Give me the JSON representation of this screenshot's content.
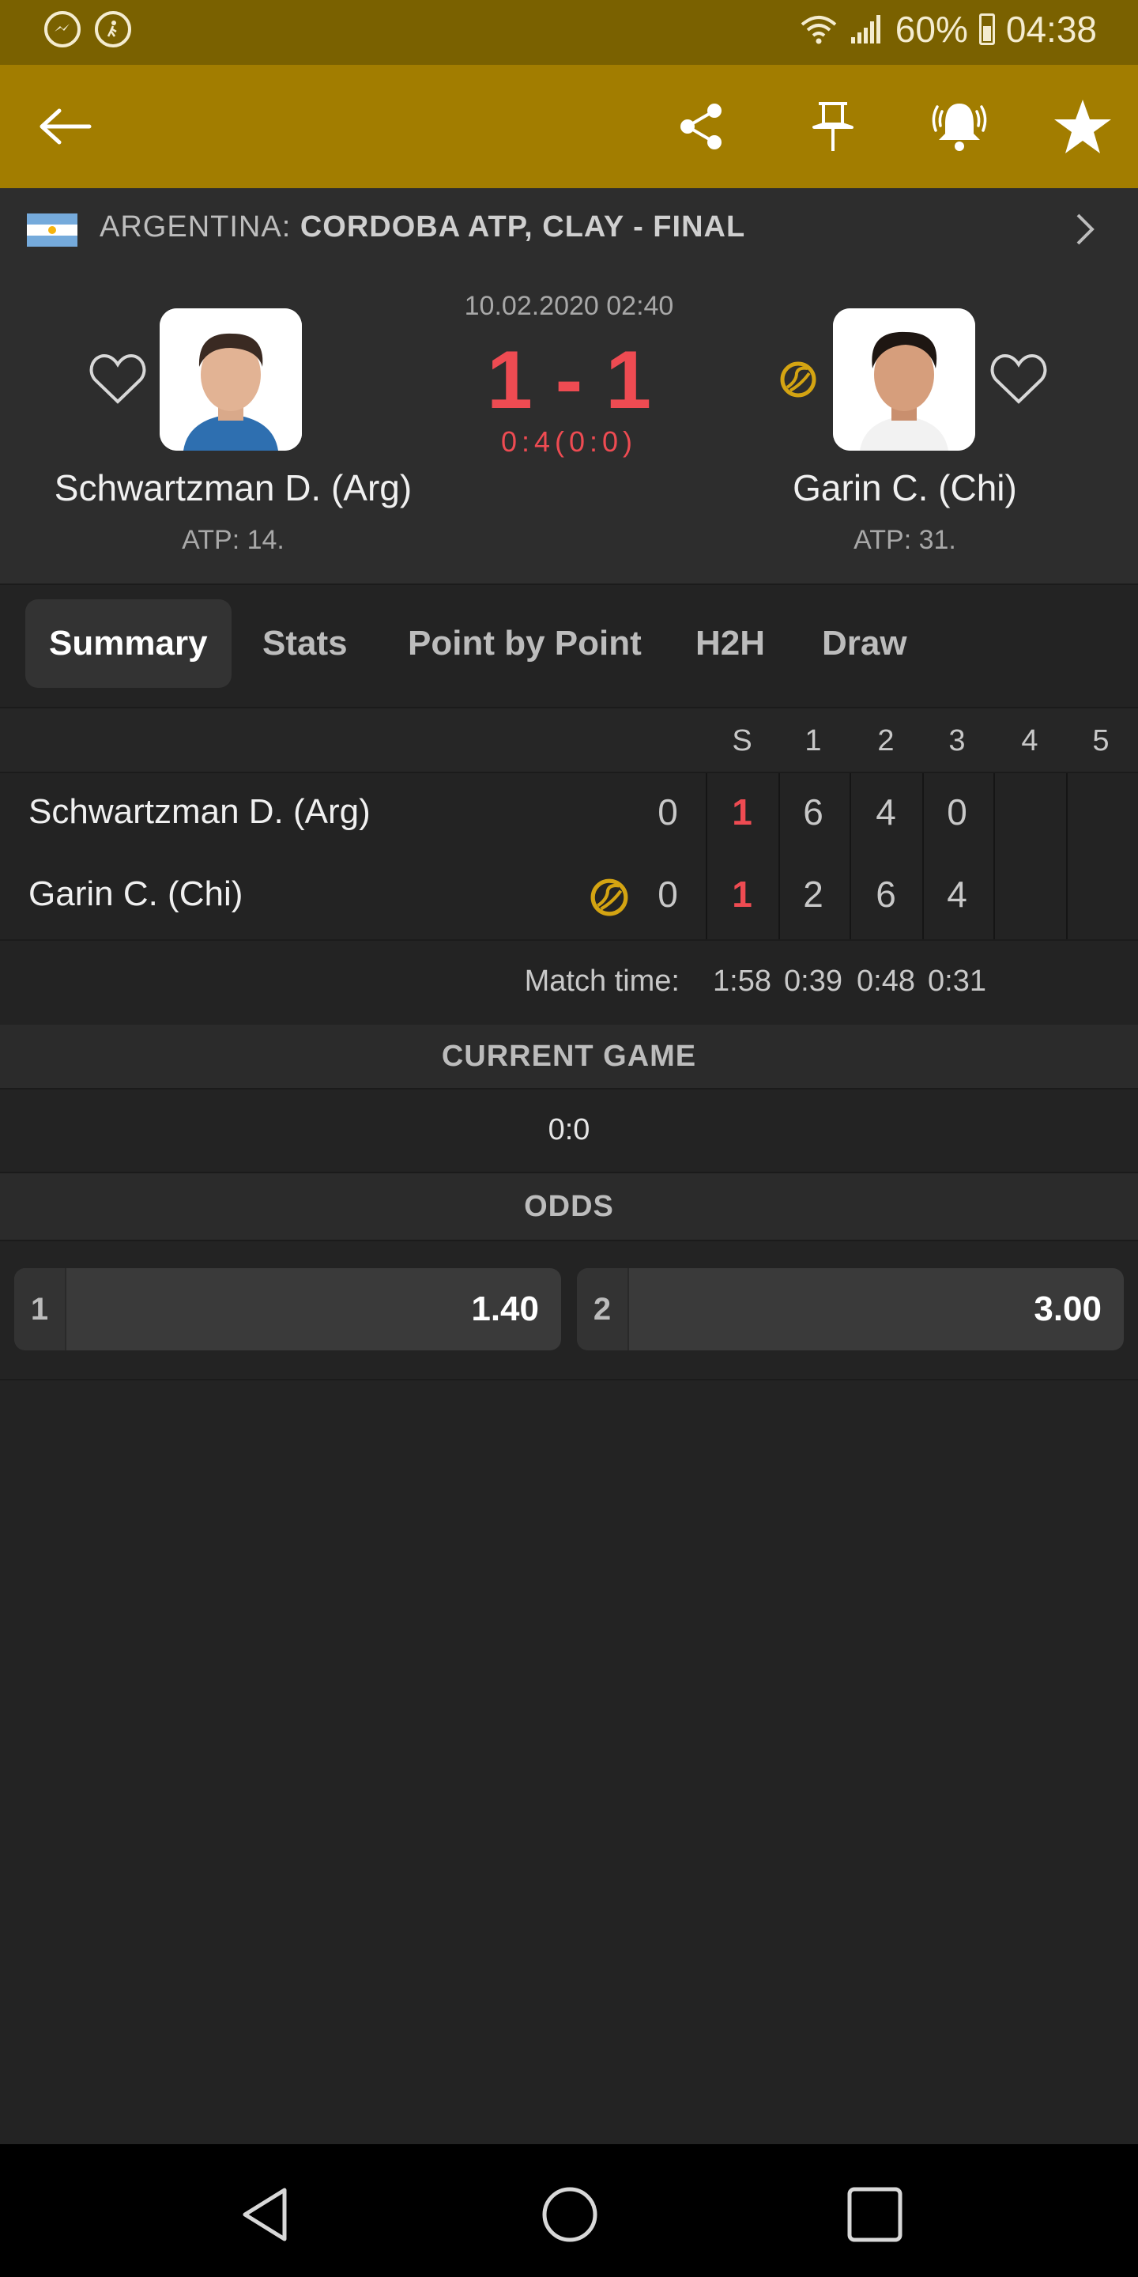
{
  "status_bar": {
    "battery": "60%",
    "time": "04:38"
  },
  "colors": {
    "toolbar": "#a27d00",
    "status_bar": "#7a6100",
    "score_red": "#ee4b52",
    "serve_ball": "#d4a412",
    "background": "#232323"
  },
  "toolbar": {
    "icons": [
      "back-arrow-icon",
      "share-icon",
      "pin-icon",
      "alarm-bell-icon",
      "star-icon"
    ]
  },
  "tournament": {
    "country": "ARGENTINA:",
    "name": "CORDOBA ATP, CLAY - FINAL"
  },
  "match": {
    "datetime": "10.02.2020 02:40",
    "score": "1 - 1",
    "game_score": "0:4(0:0)",
    "home": {
      "name": "Schwartzman D. (Arg)",
      "rank": "ATP: 14."
    },
    "away": {
      "name": "Garin C. (Chi)",
      "rank": "ATP: 31.",
      "serving": true
    }
  },
  "tabs": [
    {
      "label": "Summary",
      "active": true
    },
    {
      "label": "Stats"
    },
    {
      "label": "Point by Point"
    },
    {
      "label": "H2H"
    },
    {
      "label": "Draw"
    }
  ],
  "score_table": {
    "headers": [
      "S",
      "1",
      "2",
      "3",
      "4",
      "5"
    ],
    "rows": [
      {
        "player": "Schwartzman D. (Arg)",
        "points": "0",
        "sets": "1",
        "set_scores": [
          "6",
          "4",
          "0"
        ]
      },
      {
        "player": "Garin C. (Chi)",
        "points": "0",
        "sets": "1",
        "set_scores": [
          "2",
          "6",
          "4"
        ]
      }
    ],
    "match_time_label": "Match time:",
    "match_time": [
      "1:58",
      "0:39",
      "0:48",
      "0:31"
    ]
  },
  "current_game": {
    "title": "CURRENT GAME",
    "score": "0:0"
  },
  "odds": {
    "title": "ODDS",
    "items": [
      {
        "label": "1",
        "value": "1.40"
      },
      {
        "label": "2",
        "value": "3.00"
      }
    ]
  }
}
